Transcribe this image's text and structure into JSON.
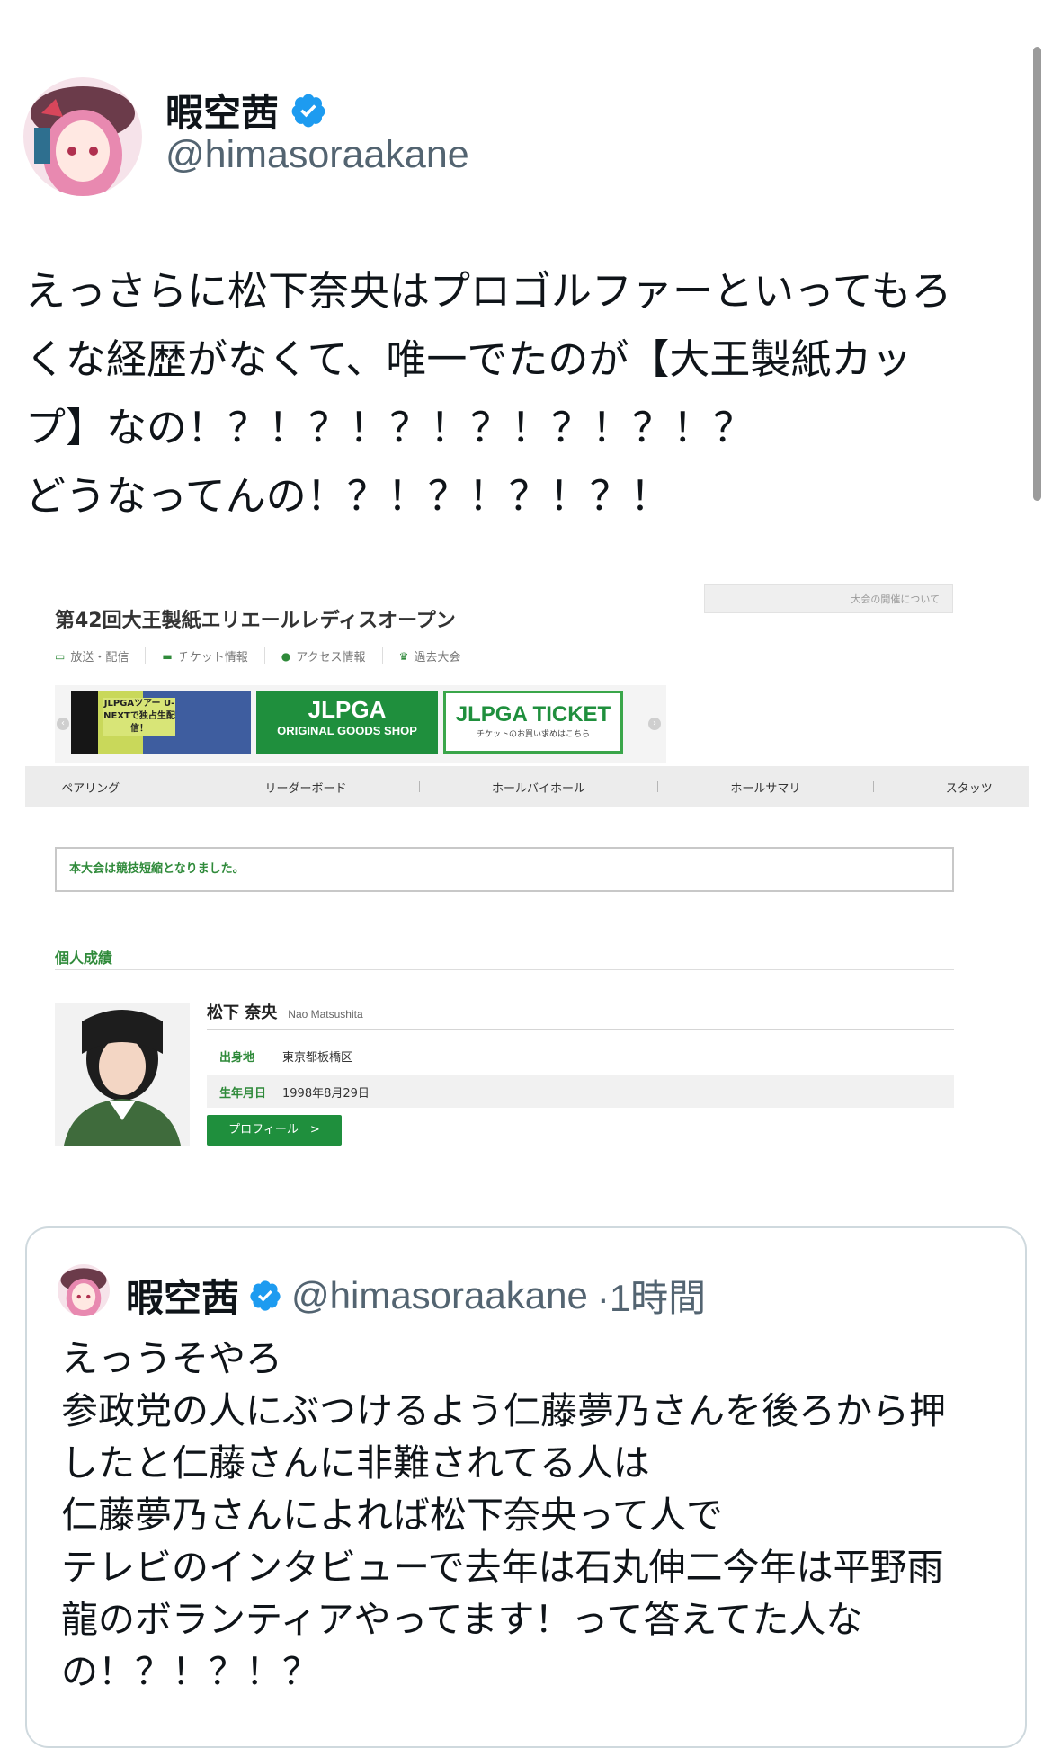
{
  "tweet": {
    "display_name": "暇空茜",
    "handle": "@himasoraakane",
    "verified_icon": "verified-badge-icon",
    "text_lines": [
      "えっさらに松下奈央はプロゴルファーといってもろ",
      "くな経歴がなくて、唯一でたのが【大王製紙カッ",
      "プ】なの！？！？！？！？！？！？！？",
      "どうなってんの！？！？！？！？！"
    ]
  },
  "embedded_page": {
    "notice_button": "大会の開催について",
    "event_title": "第42回大王製紙エリエールレディスオープン",
    "sub_links": [
      {
        "icon": "tv-icon",
        "label": "放送・配信"
      },
      {
        "icon": "ticket-icon",
        "label": "チケット情報"
      },
      {
        "icon": "map-pin-icon",
        "label": "アクセス情報"
      },
      {
        "icon": "trophy-icon",
        "label": "過去大会"
      }
    ],
    "banners": {
      "unext": "JLPGAツアー U-NEXTで独占生配信！",
      "shop_title": "JLPGA",
      "shop_sub": "ORIGINAL GOODS SHOP",
      "ticket_title": "JLPGA TICKET",
      "ticket_sub": "チケットのお買い求めはこちら"
    },
    "tabs": [
      "ペアリング",
      "リーダーボード",
      "ホールバイホール",
      "ホールサマリ",
      "スタッツ"
    ],
    "alert": "本大会は競技短縮となりました。",
    "section_title": "個人成績",
    "player": {
      "name": "松下 奈央",
      "name_en": "Nao Matsushita",
      "birthplace_label": "出身地",
      "birthplace": "東京都板橋区",
      "birthdate_label": "生年月日",
      "birthdate": "1998年8月29日",
      "profile_button": "プロフィール　>"
    }
  },
  "quoted_tweet": {
    "display_name": "暇空茜",
    "handle": "@himasoraakane",
    "time": "·1時間",
    "text_lines": [
      "えっうそやろ",
      "参政党の人にぶつけるよう仁藤夢乃さんを後ろから押",
      "したと仁藤さんに非難されてる人は",
      "仁藤夢乃さんによれば松下奈央って人で",
      "テレビのインタビューで去年は石丸伸二今年は平野雨",
      "龍のボランティアやってます！って答えてた人な",
      "の！？！？！？"
    ]
  },
  "colors": {
    "verified_blue": "#1d9bf0",
    "jlpga_green": "#1f8f3d",
    "secondary_text": "#536471"
  }
}
